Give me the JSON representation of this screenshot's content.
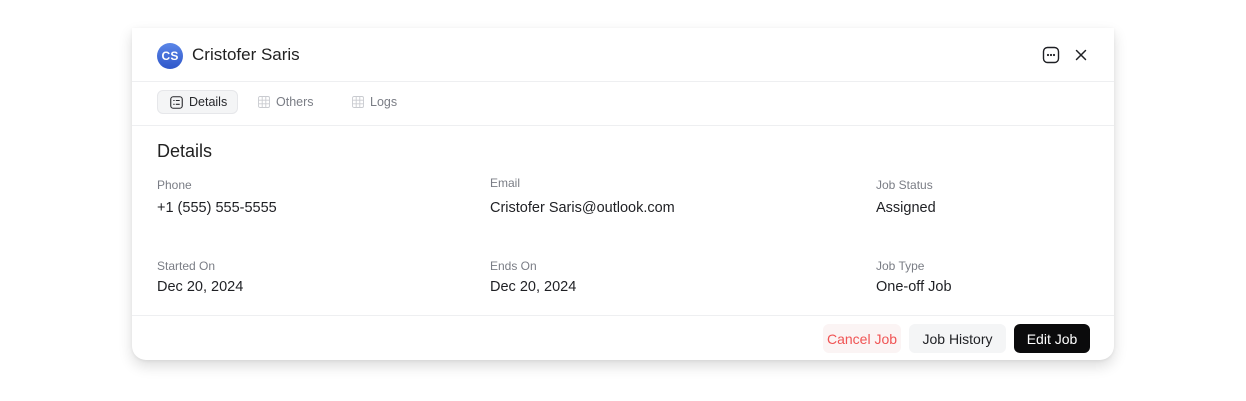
{
  "header": {
    "avatar_initials": "CS",
    "title": "Cristofer Saris",
    "more_icon": "more-dots-icon",
    "close_icon": "close-icon"
  },
  "tabs": [
    {
      "label": "Details",
      "icon": "list-icon",
      "active": true
    },
    {
      "label": "Others",
      "icon": "grid-icon",
      "active": false
    },
    {
      "label": "Logs",
      "icon": "grid-icon",
      "active": false
    }
  ],
  "details": {
    "title": "Details",
    "fields": [
      {
        "label": "Phone",
        "value": "+1 (555) 555-5555"
      },
      {
        "label": "Email",
        "value": "Cristofer Saris@outlook.com"
      },
      {
        "label": "Job Status",
        "value": "Assigned"
      },
      {
        "label": "Started On",
        "value": "Dec 20, 2024"
      },
      {
        "label": "Ends On",
        "value": "Dec 20, 2024"
      },
      {
        "label": "Job Type",
        "value": "One-off Job"
      }
    ]
  },
  "footer": {
    "cancel_label": "Cancel Job",
    "history_label": "Job History",
    "edit_label": "Edit Job"
  },
  "colors": {
    "accent_avatar": "#3d67d6",
    "danger": "#f05454",
    "primary_button": "#0b0b0c"
  }
}
